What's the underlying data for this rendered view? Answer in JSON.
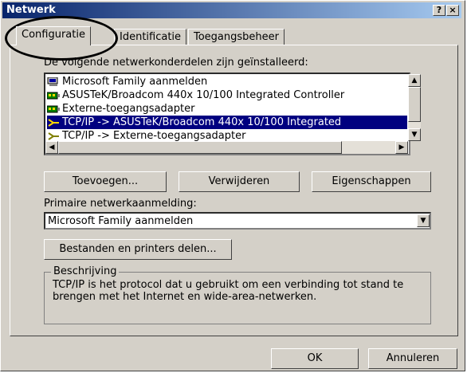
{
  "window": {
    "title": "Netwerk",
    "help_label": "?",
    "close_label": "×"
  },
  "tabs": [
    {
      "label": "Configuratie"
    },
    {
      "label": "Identificatie"
    },
    {
      "label": "Toegangsbeheer"
    }
  ],
  "components_label": "De volgende netwerkonderdelen zijn geïnstalleerd:",
  "components": [
    {
      "label": "Microsoft Family aanmelden",
      "icon": "computer-icon"
    },
    {
      "label": "ASUSTeK/Broadcom 440x 10/100 Integrated Controller",
      "icon": "network-adapter-icon"
    },
    {
      "label": "Externe-toegangsadapter",
      "icon": "network-adapter-icon"
    },
    {
      "label": "TCP/IP -> ASUSTeK/Broadcom 440x 10/100 Integrated",
      "icon": "protocol-icon",
      "selected": true
    },
    {
      "label": "TCP/IP -> Externe-toegangsadapter",
      "icon": "protocol-icon"
    }
  ],
  "buttons": {
    "add": "Toevoegen...",
    "remove": "Verwijderen",
    "properties": "Eigenschappen",
    "file_print": "Bestanden en printers delen...",
    "ok": "OK",
    "cancel": "Annuleren"
  },
  "primary_logon_label": "Primaire netwerkaanmelding:",
  "primary_logon_value": "Microsoft Family aanmelden",
  "description_title": "Beschrijving",
  "description_text": "TCP/IP is het protocol dat u gebruikt om een verbinding tot stand te brengen met het Internet en wide-area-netwerken."
}
